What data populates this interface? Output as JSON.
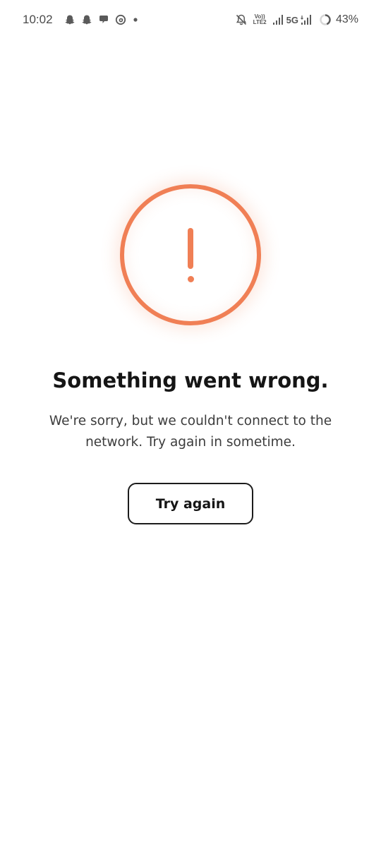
{
  "status_bar": {
    "time": "10:02",
    "notification_icons": [
      "snapchat-icon",
      "snapchat-icon",
      "chat-bubble-icon",
      "threads-icon",
      "dot-icon"
    ],
    "volte_top": "Vo))",
    "volte_bottom": "LTE2",
    "network_type": "5G",
    "battery_percent": "43%"
  },
  "error": {
    "icon": "exclamation-alert-icon",
    "title": "Something went wrong.",
    "message": "We're sorry, but we couldn't connect to the network. Try again in sometime.",
    "retry_label": "Try again"
  },
  "colors": {
    "accent": "#f07f55",
    "text": "#151515",
    "background": "#ffffff"
  }
}
